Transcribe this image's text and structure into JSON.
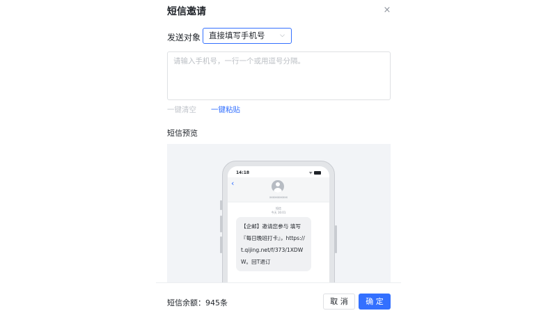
{
  "dialog": {
    "title": "短信邀请",
    "close_icon": "×"
  },
  "recipient": {
    "label": "发送对象",
    "selected": "直接填写手机号",
    "chevron": "⌵"
  },
  "phones_input": {
    "placeholder": "请输入手机号，一行一个或用逗号分隔。",
    "value": ""
  },
  "actions": {
    "clear_label": "一键清空",
    "paste_label": "一键粘贴"
  },
  "preview": {
    "label": "短信预览",
    "phone": {
      "time": "14:18",
      "signal": "ᯤ",
      "sender": "xxxxxxxxxxx",
      "meta_line1": "短信",
      "meta_line2": "今天 16:01",
      "message": "【企邮】邀请您参与 填写『每日晚班打卡』，https://t.qijing.net/f/373/1XDWW。回T退订"
    }
  },
  "footer": {
    "balance": "短信余额：945条",
    "cancel_label": "取 消",
    "ok_label": "确 定"
  },
  "colors": {
    "accent": "#3370ff",
    "border": "#dee0e3",
    "muted": "#8f959e"
  }
}
